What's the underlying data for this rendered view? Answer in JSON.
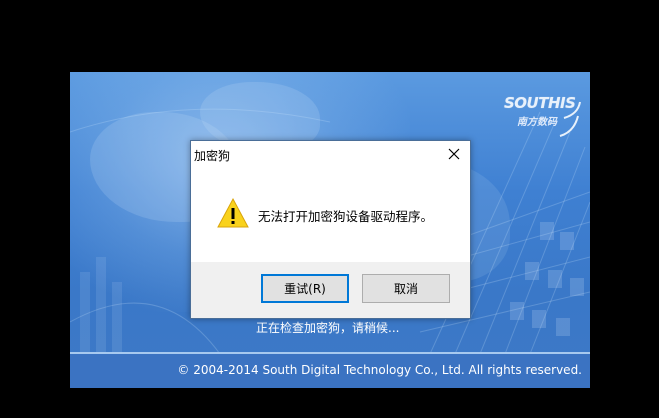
{
  "splash": {
    "logo": {
      "brand": "SOUTHIS",
      "sub": "南方数码"
    },
    "status_text": "正在检查加密狗，请稍候...",
    "copyright": "©  2004-2014 South Digital Technology Co., Ltd. All rights reserved."
  },
  "dialog": {
    "title": "加密狗",
    "message": "无法打开加密狗设备驱动程序。",
    "buttons": {
      "retry": "重试(R)",
      "cancel": "取消"
    },
    "icons": {
      "warning": "warning-icon",
      "close": "close-icon"
    }
  },
  "colors": {
    "splash_blue": "#3f80d2",
    "footer_blue": "#3b73c2",
    "focus_border": "#0078d7",
    "warning_yellow": "#f9d21c"
  }
}
